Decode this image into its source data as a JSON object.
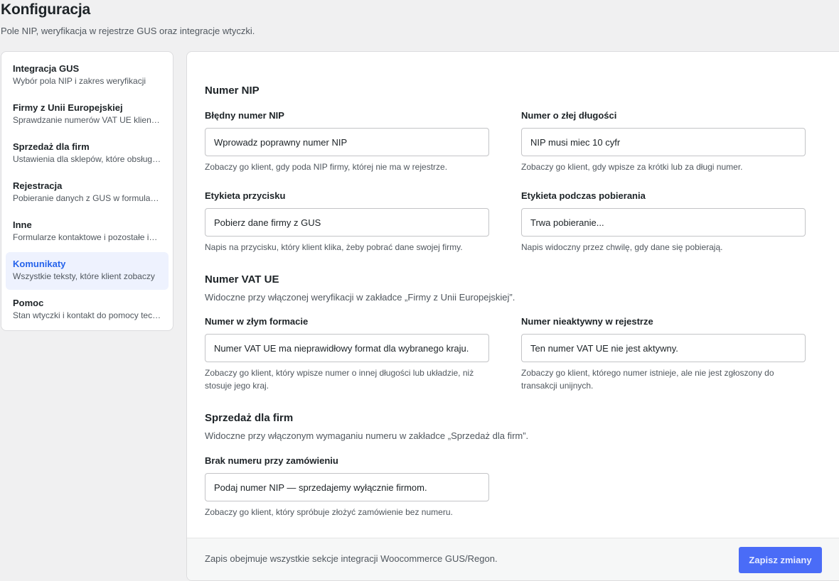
{
  "header": {
    "title": "Konfiguracja",
    "subtitle": "Pole NIP, weryfikacja w rejestrze GUS oraz integracje wtyczki."
  },
  "sidebar": {
    "items": [
      {
        "title": "Integracja GUS",
        "desc": "Wybór pola NIP i zakres weryfikacji",
        "active": false
      },
      {
        "title": "Firmy z Unii Europejskiej",
        "desc": "Sprawdzanie numerów VAT UE klientów",
        "active": false
      },
      {
        "title": "Sprzedaż dla firm",
        "desc": "Ustawienia dla sklepów, które obsługują firmy",
        "active": false
      },
      {
        "title": "Rejestracja",
        "desc": "Pobieranie danych z GUS w formularzu rejestracji",
        "active": false
      },
      {
        "title": "Inne",
        "desc": "Formularze kontaktowe i pozostałe integracje",
        "active": false
      },
      {
        "title": "Komunikaty",
        "desc": "Wszystkie teksty, które klient zobaczy",
        "active": true
      },
      {
        "title": "Pomoc",
        "desc": "Stan wtyczki i kontakt do pomocy technicznej",
        "active": false
      }
    ]
  },
  "main": {
    "nip": {
      "title": "Numer NIP",
      "invalid": {
        "label": "Błędny numer NIP",
        "value": "Wprowadz poprawny numer NIP",
        "help": "Zobaczy go klient, gdy poda NIP firmy, której nie ma w rejestrze."
      },
      "length": {
        "label": "Numer o złej długości",
        "value": "NIP musi miec 10 cyfr",
        "help": "Zobaczy go klient, gdy wpisze za krótki lub za długi numer."
      },
      "button_label": {
        "label": "Etykieta przycisku",
        "value": "Pobierz dane firmy z GUS",
        "help": "Napis na przycisku, który klient klika, żeby pobrać dane swojej firmy."
      },
      "loading_label": {
        "label": "Etykieta podczas pobierania",
        "value": "Trwa pobieranie...",
        "help": "Napis widoczny przez chwilę, gdy dane się pobierają."
      }
    },
    "vat": {
      "title": "Numer VAT UE",
      "desc": "Widoczne przy włączonej weryfikacji w zakładce „Firmy z Unii Europejskiej”.",
      "format": {
        "label": "Numer w złym formacie",
        "value": "Numer VAT UE ma nieprawidłowy format dla wybranego kraju.",
        "help": "Zobaczy go klient, który wpisze numer o innej długości lub układzie, niż stosuje jego kraj."
      },
      "inactive": {
        "label": "Numer nieaktywny w rejestrze",
        "value": "Ten numer VAT UE nie jest aktywny.",
        "help": "Zobaczy go klient, którego numer istnieje, ale nie jest zgłoszony do transakcji unijnych."
      }
    },
    "b2b": {
      "title": "Sprzedaż dla firm",
      "desc": "Widoczne przy włączonym wymaganiu numeru w zakładce „Sprzedaż dla firm”.",
      "missing": {
        "label": "Brak numeru przy zamówieniu",
        "value": "Podaj numer NIP — sprzedajemy wyłącznie firmom.",
        "help": "Zobaczy go klient, który spróbuje złożyć zamówienie bez numeru."
      }
    }
  },
  "footer": {
    "note": "Zapis obejmuje wszystkie sekcje integracji Woocommerce GUS/Regon.",
    "save_label": "Zapisz zmiany"
  },
  "colors": {
    "accent": "#2563eb",
    "button": "#4a6cf7",
    "active_bg": "#eef2fe"
  }
}
